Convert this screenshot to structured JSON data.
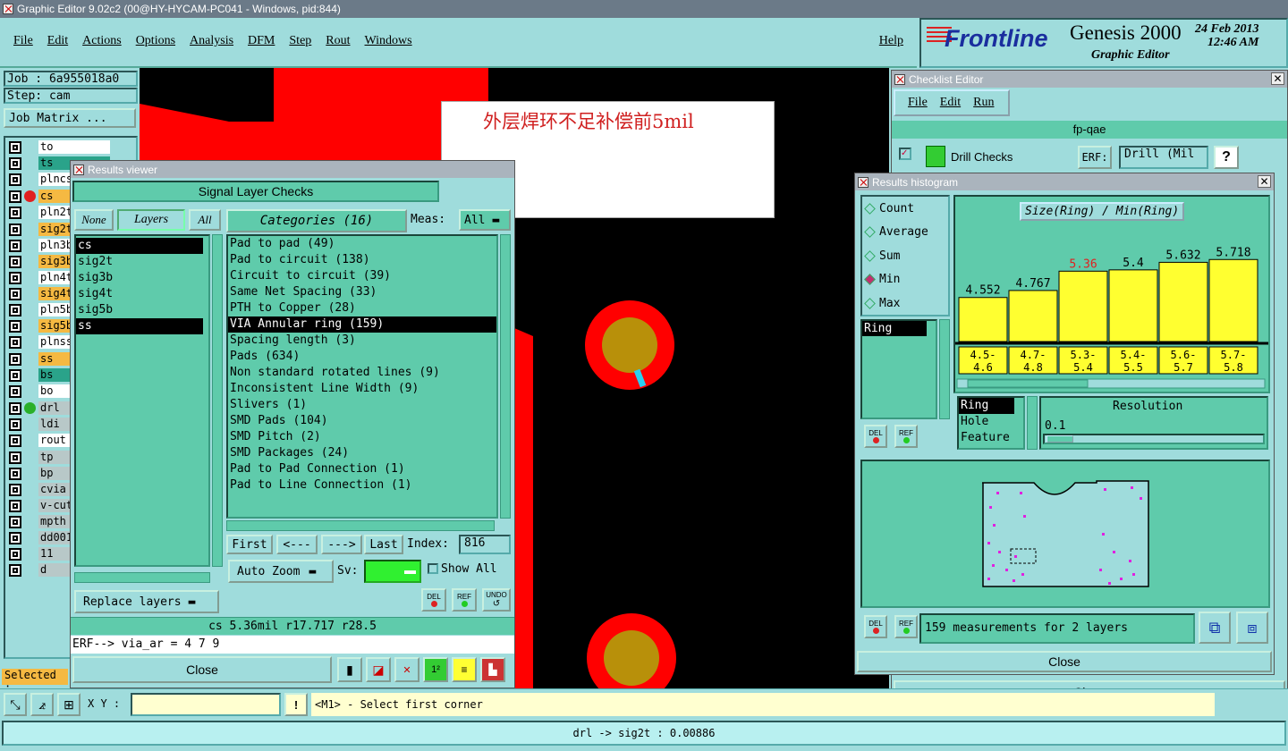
{
  "app": {
    "title": "Graphic Editor 9.02c2 (00@HY-HYCAM-PC041 - Windows, pid:844)"
  },
  "menu": {
    "items": [
      "File",
      "Edit",
      "Actions",
      "Options",
      "Analysis",
      "DFM",
      "Step",
      "Rout",
      "Windows"
    ],
    "help": "Help"
  },
  "brand": {
    "logo": "Frontline",
    "product": "Genesis 2000",
    "subtitle": "Graphic Editor",
    "date": "24 Feb 2013",
    "time": "12:46 AM"
  },
  "job": {
    "job_label": "Job : 6a955018a0",
    "step_label": "Step: cam",
    "job_matrix": "Job Matrix ..."
  },
  "layers": [
    {
      "name": "to",
      "color": "#ffffff",
      "marker": ""
    },
    {
      "name": "ts",
      "color": "#2aa38a",
      "marker": ""
    },
    {
      "name": "plncs",
      "color": "#ffffff",
      "marker": ""
    },
    {
      "name": "cs",
      "color": "#f5b942",
      "marker": "red"
    },
    {
      "name": "pln2t",
      "color": "#ffffff",
      "marker": ""
    },
    {
      "name": "sig2t",
      "color": "#f5b942",
      "marker": ""
    },
    {
      "name": "pln3b",
      "color": "#ffffff",
      "marker": ""
    },
    {
      "name": "sig3b",
      "color": "#f5b942",
      "marker": ""
    },
    {
      "name": "pln4t",
      "color": "#ffffff",
      "marker": ""
    },
    {
      "name": "sig4t",
      "color": "#f5b942",
      "marker": ""
    },
    {
      "name": "pln5b",
      "color": "#ffffff",
      "marker": ""
    },
    {
      "name": "sig5b",
      "color": "#f5b942",
      "marker": ""
    },
    {
      "name": "plnss",
      "color": "#ffffff",
      "marker": ""
    },
    {
      "name": "ss",
      "color": "#f5b942",
      "marker": ""
    },
    {
      "name": "bs",
      "color": "#2aa38a",
      "marker": ""
    },
    {
      "name": "bo",
      "color": "#ffffff",
      "marker": ""
    },
    {
      "name": "drl",
      "color": "#b8c8c8",
      "marker": "green"
    },
    {
      "name": "ldi",
      "color": "#b8c8c8",
      "marker": ""
    },
    {
      "name": "rout",
      "color": "#ffffff",
      "marker": ""
    },
    {
      "name": "tp",
      "color": "#b8c8c8",
      "marker": ""
    },
    {
      "name": "bp",
      "color": "#b8c8c8",
      "marker": ""
    },
    {
      "name": "cvia",
      "color": "#b8c8c8",
      "marker": ""
    },
    {
      "name": "v-cut",
      "color": "#b8c8c8",
      "marker": ""
    },
    {
      "name": "mpth",
      "color": "#b8c8c8",
      "marker": ""
    },
    {
      "name": "dd001",
      "color": "#b8c8c8",
      "marker": ""
    },
    {
      "name": "11",
      "color": "#b8c8c8",
      "marker": ""
    },
    {
      "name": "d",
      "color": "#b8c8c8",
      "marker": ""
    }
  ],
  "selected_label": "Selected :",
  "annotation": "外层焊环不足补偿前5mil",
  "results_viewer": {
    "title": "Results viewer",
    "header": "Signal Layer Checks",
    "none": "None",
    "layers_tab": "Layers",
    "all": "All",
    "categories_label": "Categories (16)",
    "meas_label": "Meas:",
    "meas_value": "All",
    "layer_list": [
      "cs",
      "sig2t",
      "sig3b",
      "sig4t",
      "sig5b",
      "ss"
    ],
    "categories": [
      "Pad to pad (49)",
      "Pad to circuit (138)",
      "Circuit to circuit (39)",
      "Same Net Spacing (33)",
      "PTH to Copper (28)",
      "VIA Annular ring (159)",
      "Spacing length (3)",
      "Pads (634)",
      "Non standard rotated lines (9)",
      "Inconsistent Line Width (9)",
      "Slivers (1)",
      "SMD Pads (104)",
      "SMD Pitch (2)",
      "SMD Packages (24)",
      "Pad to Pad Connection (1)",
      "Pad to Line Connection (1)"
    ],
    "first": "First",
    "prev": "<---",
    "next": "--->",
    "last": "Last",
    "index_label": "Index:",
    "index_value": "816",
    "auto_zoom": "Auto Zoom",
    "sv_label": "Sv:",
    "show_all": "Show All",
    "replace_layers": "Replace layers",
    "del": "DEL",
    "ref": "REF",
    "undo": "UNDO",
    "status": "cs 5.36mil   r17.717   r28.5",
    "erf": "ERF--> via_ar = 4 7 9",
    "close": "Close"
  },
  "checklist": {
    "title": "Checklist Editor",
    "menu": [
      "File",
      "Edit",
      "Run"
    ],
    "name": "fp-qae",
    "row_label": "Drill Checks",
    "erf": "ERF:",
    "erf_value": "Drill (Mil",
    "q": "?",
    "close": "Close"
  },
  "histogram": {
    "title": "Results histogram",
    "modes": [
      "Count",
      "Average",
      "Sum",
      "Min",
      "Max"
    ],
    "selected_mode": "Min",
    "chart_title": "Size(Ring) / Min(Ring)",
    "list_left": [
      "Ring"
    ],
    "attr_list": [
      "Ring",
      "Hole",
      "Feature"
    ],
    "resolution_label": "Resolution",
    "resolution_value": "0.1",
    "del": "DEL",
    "ref": "REF",
    "measurements": "159 measurements for 2 layers",
    "close": "Close"
  },
  "chart_data": {
    "type": "bar",
    "title": "Size(Ring) / Min(Ring)",
    "categories": [
      "4.5-4.6",
      "4.7-4.8",
      "5.3-5.4",
      "5.4-5.5",
      "5.6-5.7",
      "5.7-5.8"
    ],
    "category_top": [
      "4.5-",
      "4.7-",
      "5.3-",
      "5.4-",
      "5.6-",
      "5.7-"
    ],
    "category_bottom": [
      "4.6",
      "4.8",
      "5.4",
      "5.5",
      "5.7",
      "5.8"
    ],
    "values": [
      4.552,
      4.767,
      5.36,
      5.4,
      5.632,
      5.718
    ],
    "labels": [
      "4.552",
      "4.767",
      "5.36",
      "5.4",
      "5.632",
      "5.718"
    ],
    "highlight_index": 2,
    "bar_color": "#ffff30",
    "highlight_label_color": "#e02020"
  },
  "coords": {
    "xy_label": "X Y :",
    "prompt": "<M1> - Select first corner"
  },
  "status_bar": "drl -> sig2t : 0.00886"
}
